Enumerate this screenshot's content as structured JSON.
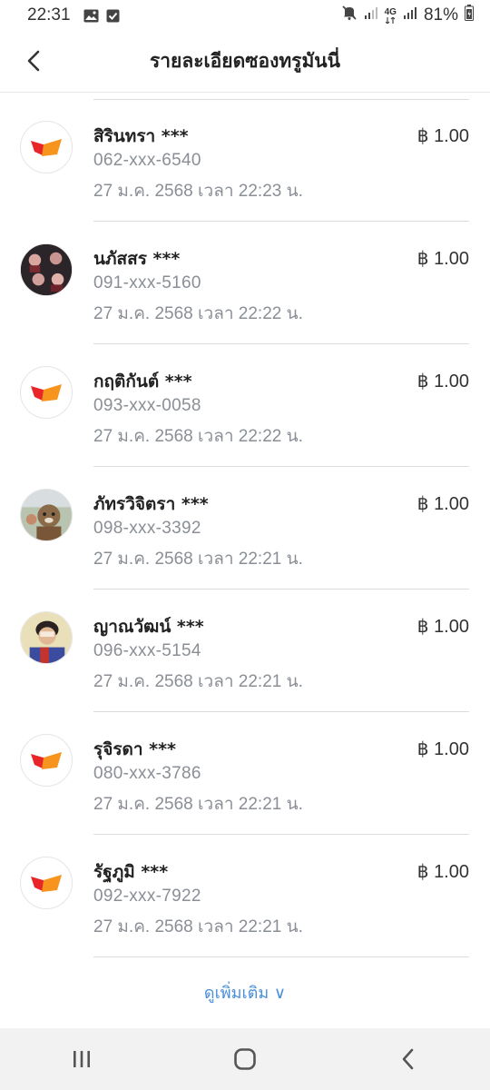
{
  "status_bar": {
    "time": "22:31",
    "battery_percent": "81%",
    "network_label": "4G",
    "icons": [
      "gallery-icon",
      "checkbox-icon",
      "mute-icon",
      "signal-icon",
      "network-4g-icon",
      "signal-icon",
      "battery-icon"
    ]
  },
  "header": {
    "title": "รายละเอียดซองทรูมันนี่",
    "back_icon": "chevron-left-icon"
  },
  "items": [
    {
      "name": "สิรินทรา ***",
      "phone": "062-xxx-6540",
      "datetime": "27 ม.ค. 2568 เวลา 22:23 น.",
      "amount": "฿ 1.00",
      "avatar": "truemoney-logo"
    },
    {
      "name": "นภัสสร ***",
      "phone": "091-xxx-5160",
      "datetime": "27 ม.ค. 2568 เวลา 22:22 น.",
      "amount": "฿ 1.00",
      "avatar": "user-photo"
    },
    {
      "name": "กฤติกันต์ ***",
      "phone": "093-xxx-0058",
      "datetime": "27 ม.ค. 2568 เวลา 22:22 น.",
      "amount": "฿ 1.00",
      "avatar": "truemoney-logo"
    },
    {
      "name": "ภัทรวิจิตรา ***",
      "phone": "098-xxx-3392",
      "datetime": "27 ม.ค. 2568 เวลา 22:21 น.",
      "amount": "฿ 1.00",
      "avatar": "user-photo"
    },
    {
      "name": "ญาณวัฒน์ ***",
      "phone": "096-xxx-5154",
      "datetime": "27 ม.ค. 2568 เวลา 22:21 น.",
      "amount": "฿ 1.00",
      "avatar": "user-photo"
    },
    {
      "name": "รุจิรดา ***",
      "phone": "080-xxx-3786",
      "datetime": "27 ม.ค. 2568 เวลา 22:21 น.",
      "amount": "฿ 1.00",
      "avatar": "truemoney-logo"
    },
    {
      "name": "รัฐภูมิ ***",
      "phone": "092-xxx-7922",
      "datetime": "27 ม.ค. 2568 เวลา 22:21 น.",
      "amount": "฿ 1.00",
      "avatar": "truemoney-logo"
    }
  ],
  "see_more": {
    "label": "ดูเพิ่มเติม ∨"
  },
  "nav_bar": {
    "icons": [
      "recents-icon",
      "home-icon",
      "back-icon"
    ]
  },
  "colors": {
    "link": "#4a8fd9",
    "secondary_text": "#8a8f96",
    "logo_red": "#e8262a",
    "logo_orange": "#f7941d"
  }
}
